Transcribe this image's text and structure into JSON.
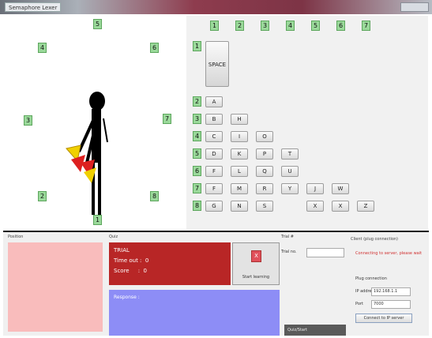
{
  "window": {
    "title": "Semaphore Lexer"
  },
  "figure_badges": [
    "1",
    "2",
    "3",
    "4",
    "5",
    "6",
    "7",
    "8"
  ],
  "keyboard": {
    "column_badges": [
      "1",
      "2",
      "3",
      "4",
      "5",
      "6",
      "7"
    ],
    "row_badges": [
      "1",
      "2",
      "3",
      "4",
      "5",
      "6",
      "7",
      "8"
    ],
    "space_label": "SPACE",
    "rows": [
      [
        "A"
      ],
      [
        "B",
        "H"
      ],
      [
        "C",
        "I",
        "O"
      ],
      [
        "D",
        "K",
        "P",
        "T"
      ],
      [
        "F",
        "L",
        "Q",
        "U"
      ],
      [
        "F",
        "M",
        "R",
        "Y",
        "J",
        "W"
      ],
      [
        "G",
        "N",
        "S",
        "X",
        "X",
        "Z"
      ]
    ]
  },
  "bottom": {
    "labels": {
      "section1": "Position",
      "section2": "Quiz",
      "section3": "Trial #",
      "section4": "Client (plug connection)"
    },
    "trial": {
      "title": "TRIAL",
      "timeout": "Time out :  0",
      "score": "Score     :  0"
    },
    "start_button": {
      "icon": "X",
      "label": "Start learning"
    },
    "response_label": "Response :",
    "trial_number": {
      "label": "Trial no.",
      "value": ""
    },
    "gray_button_label": "Quiz/Start",
    "connection": {
      "status": "Connecting to server, please wait",
      "settings_label": "Plug connection",
      "ip_label": "IP address",
      "ip_value": "192.168.1.1",
      "port_label": "Port",
      "port_value": "7000",
      "connect_label": "Connect to IP server"
    }
  },
  "colors": {
    "accent_green": "#9ad99a",
    "trial_red": "#b82626",
    "response_blue": "#8d8df6",
    "pink": "#f9bcbc"
  }
}
